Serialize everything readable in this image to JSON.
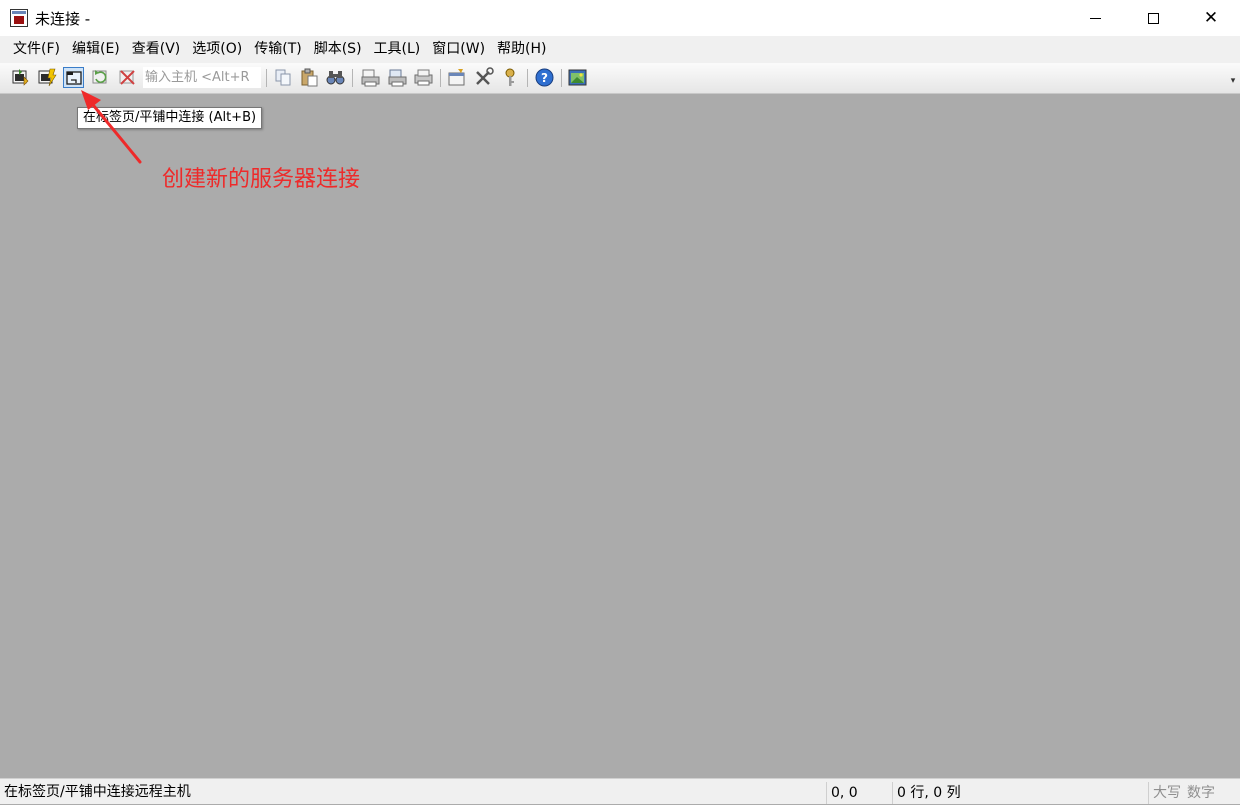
{
  "window": {
    "title": "未连接 -"
  },
  "menu": [
    "文件(F)",
    "编辑(E)",
    "查看(V)",
    "选项(O)",
    "传输(T)",
    "脚本(S)",
    "工具(L)",
    "窗口(W)",
    "帮助(H)"
  ],
  "toolbar": {
    "host_placeholder": "输入主机 <Alt+R"
  },
  "tooltip": "在标签页/平铺中连接 (Alt+B)",
  "annotation": "创建新的服务器连接",
  "status": {
    "message": "在标签页/平铺中连接远程主机",
    "cursor_pos": "0, 0",
    "rows_cols": "0 行, 0 列",
    "caps": "大写",
    "num": "数字"
  },
  "colors": {
    "annotation": "#ee2a2a",
    "workspace": "#ababab"
  }
}
